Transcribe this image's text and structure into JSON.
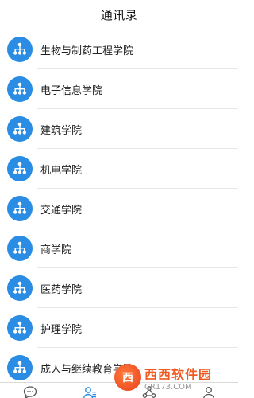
{
  "header": {
    "title": "通讯录"
  },
  "list": {
    "items": [
      {
        "label": "生物与制药工程学院"
      },
      {
        "label": "电子信息学院"
      },
      {
        "label": "建筑学院"
      },
      {
        "label": "机电学院"
      },
      {
        "label": "交通学院"
      },
      {
        "label": "商学院"
      },
      {
        "label": "医药学院"
      },
      {
        "label": "护理学院"
      },
      {
        "label": "成人与继续教育学院"
      }
    ]
  },
  "tabbar": {
    "tabs": [
      {
        "icon": "chat-bubble-icon"
      },
      {
        "icon": "contacts-icon",
        "active": true
      },
      {
        "icon": "share-icon"
      },
      {
        "icon": "profile-icon"
      }
    ]
  },
  "watermark": {
    "main": "西西软件园",
    "sub": "CR173.COM"
  },
  "colors": {
    "accent": "#2a8ce3",
    "watermark": "#f05a22"
  }
}
